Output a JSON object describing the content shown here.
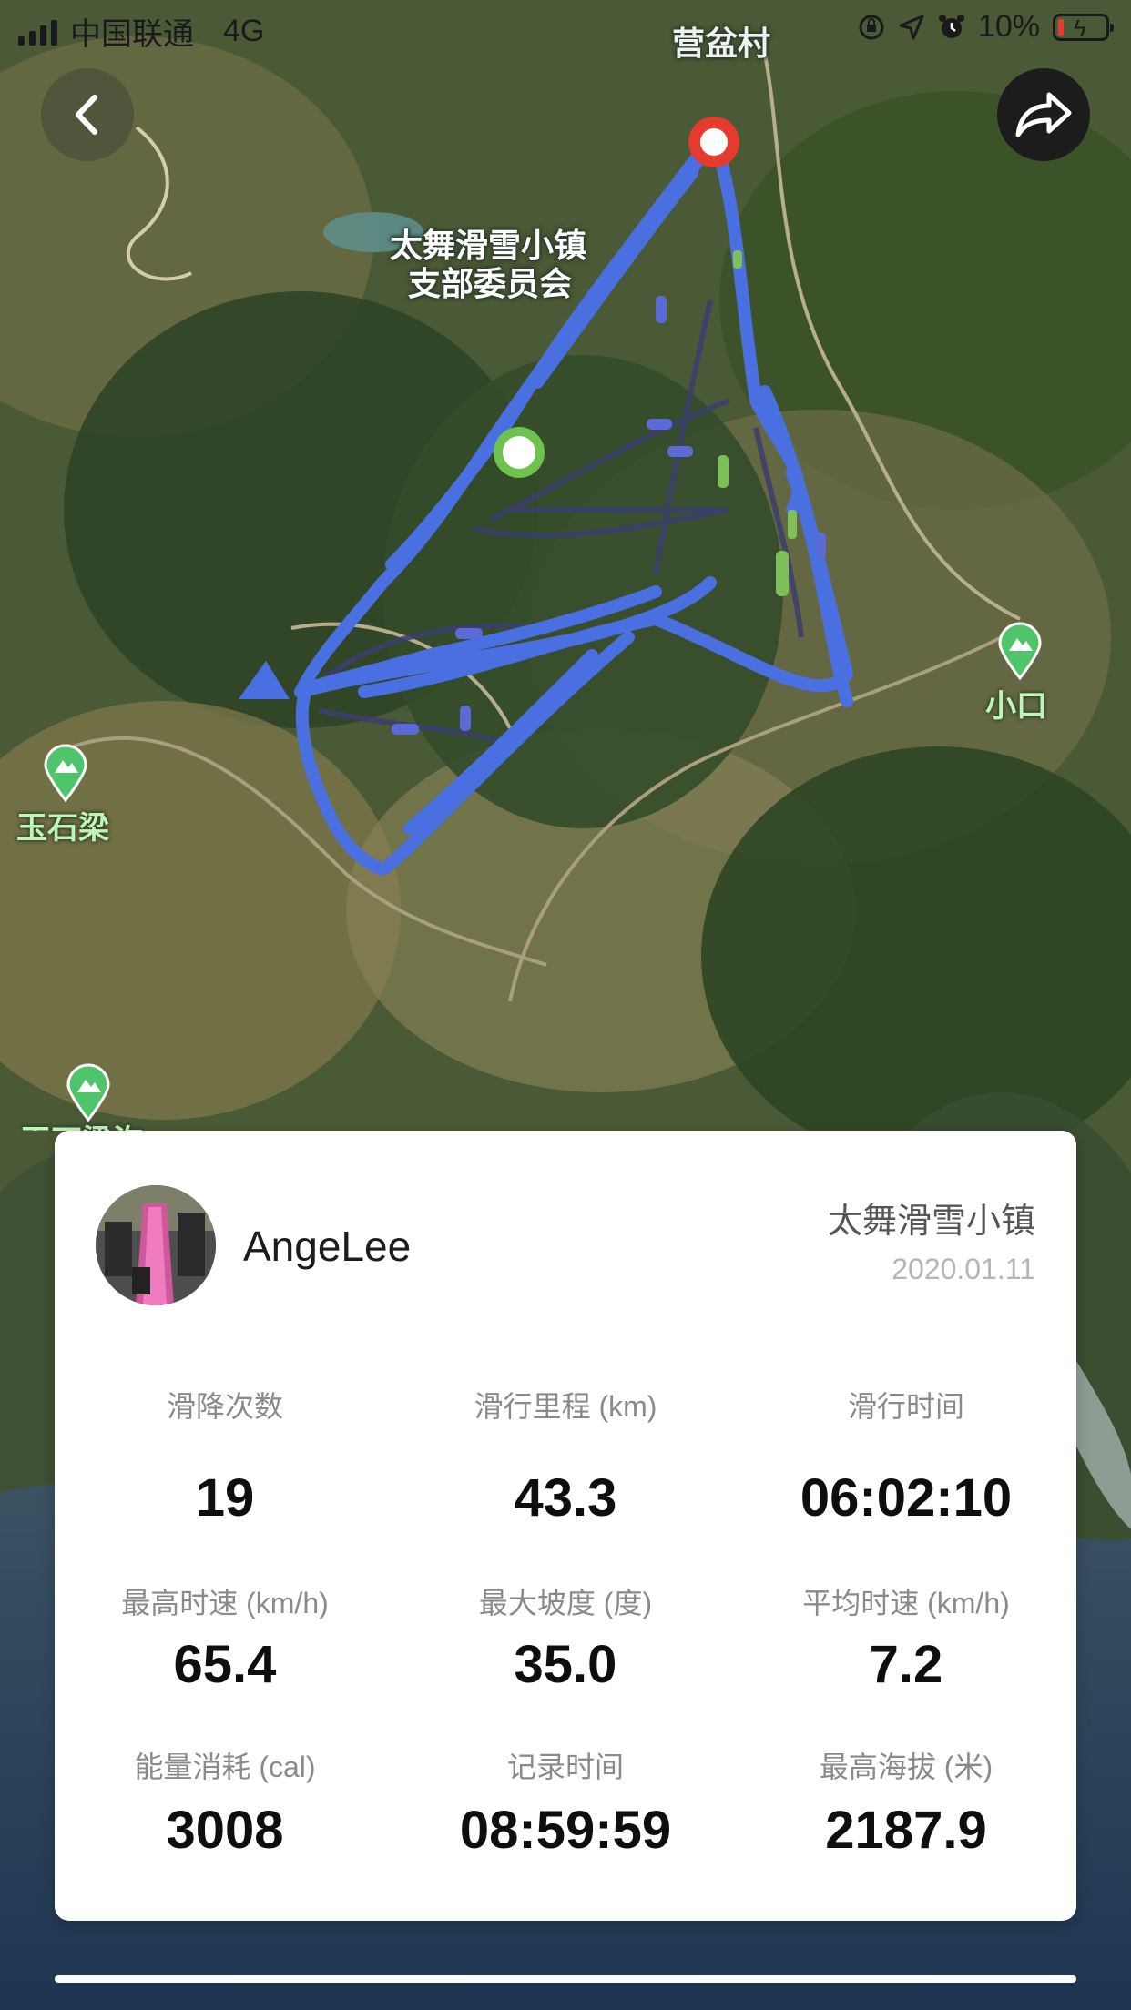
{
  "status_bar": {
    "carrier": "中国联通",
    "network": "4G",
    "battery": "10%",
    "icons": [
      "orientation-lock-icon",
      "location-arrow-icon",
      "alarm-icon",
      "battery-icon"
    ]
  },
  "nav": {
    "back_icon": "chevron-left-icon",
    "share_icon": "share-arrow-icon"
  },
  "map": {
    "labels": {
      "village": "营盆村",
      "committee_line1": "太舞滑雪小镇",
      "committee_line2": "支部委员会",
      "poi_xiaokou": "小口",
      "poi_yushiliang": "玉石梁",
      "poi_partial": "玉石梁沟"
    },
    "colors": {
      "track": "#4a6fe0",
      "start_marker": "#6ec24e",
      "end_marker": "#e53a2e",
      "poi": "#4ec56a"
    }
  },
  "profile": {
    "username": "AngeLee",
    "resort": "太舞滑雪小镇",
    "date": "2020.01.11"
  },
  "stats": [
    {
      "label": "滑降次数",
      "value": "19"
    },
    {
      "label": "滑行里程 (km)",
      "value": "43.3"
    },
    {
      "label": "滑行时间",
      "value": "06:02:10"
    },
    {
      "label": "最高时速 (km/h)",
      "value": "65.4"
    },
    {
      "label": "最大坡度 (度)",
      "value": "35.0"
    },
    {
      "label": "平均时速 (km/h)",
      "value": "7.2"
    },
    {
      "label": "能量消耗 (cal)",
      "value": "3008"
    },
    {
      "label": "记录时间",
      "value": "08:59:59"
    },
    {
      "label": "最高海拔 (米)",
      "value": "2187.9"
    }
  ]
}
